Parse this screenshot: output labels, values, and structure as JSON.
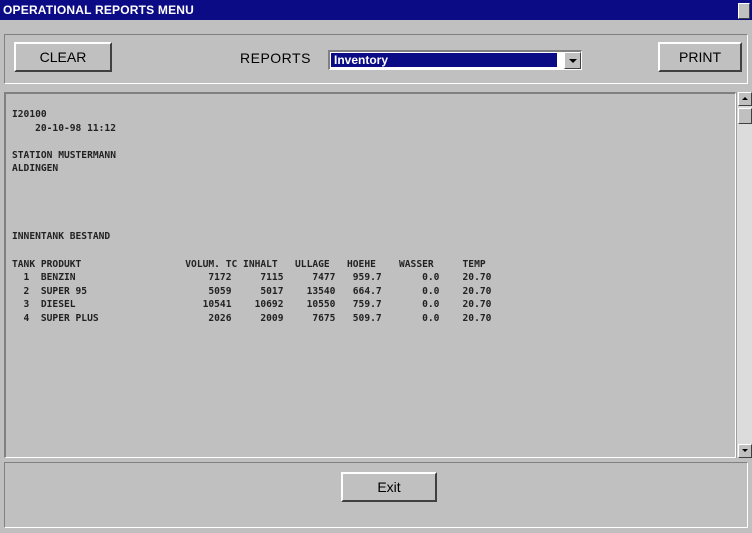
{
  "window": {
    "title": "OPERATIONAL REPORTS MENU"
  },
  "toolbar": {
    "clear_label": "CLEAR",
    "reports_label": "REPORTS",
    "report_selected": "Inventory",
    "print_label": "PRINT"
  },
  "report": {
    "lines": [
      "I20100",
      "    20-10-98 11:12",
      "",
      "STATION MUSTERMANN",
      "ALDINGEN",
      "",
      "",
      "",
      "",
      "INNENTANK BESTAND",
      "",
      "TANK PRODUKT                  VOLUM. TC INHALT   ULLAGE   HOEHE    WASSER     TEMP",
      "  1  BENZIN                       7172     7115     7477   959.7       0.0    20.70",
      "  2  SUPER 95                     5059     5017    13540   664.7       0.0    20.70",
      "  3  DIESEL                      10541    10692    10550   759.7       0.0    20.70",
      "  4  SUPER PLUS                   2026     2009     7675   509.7       0.0    20.70"
    ]
  },
  "footer": {
    "exit_label": "Exit"
  },
  "colors": {
    "titlebar": "#0b0b86",
    "face": "#c0c0c0",
    "selection": "#0b0b86"
  }
}
